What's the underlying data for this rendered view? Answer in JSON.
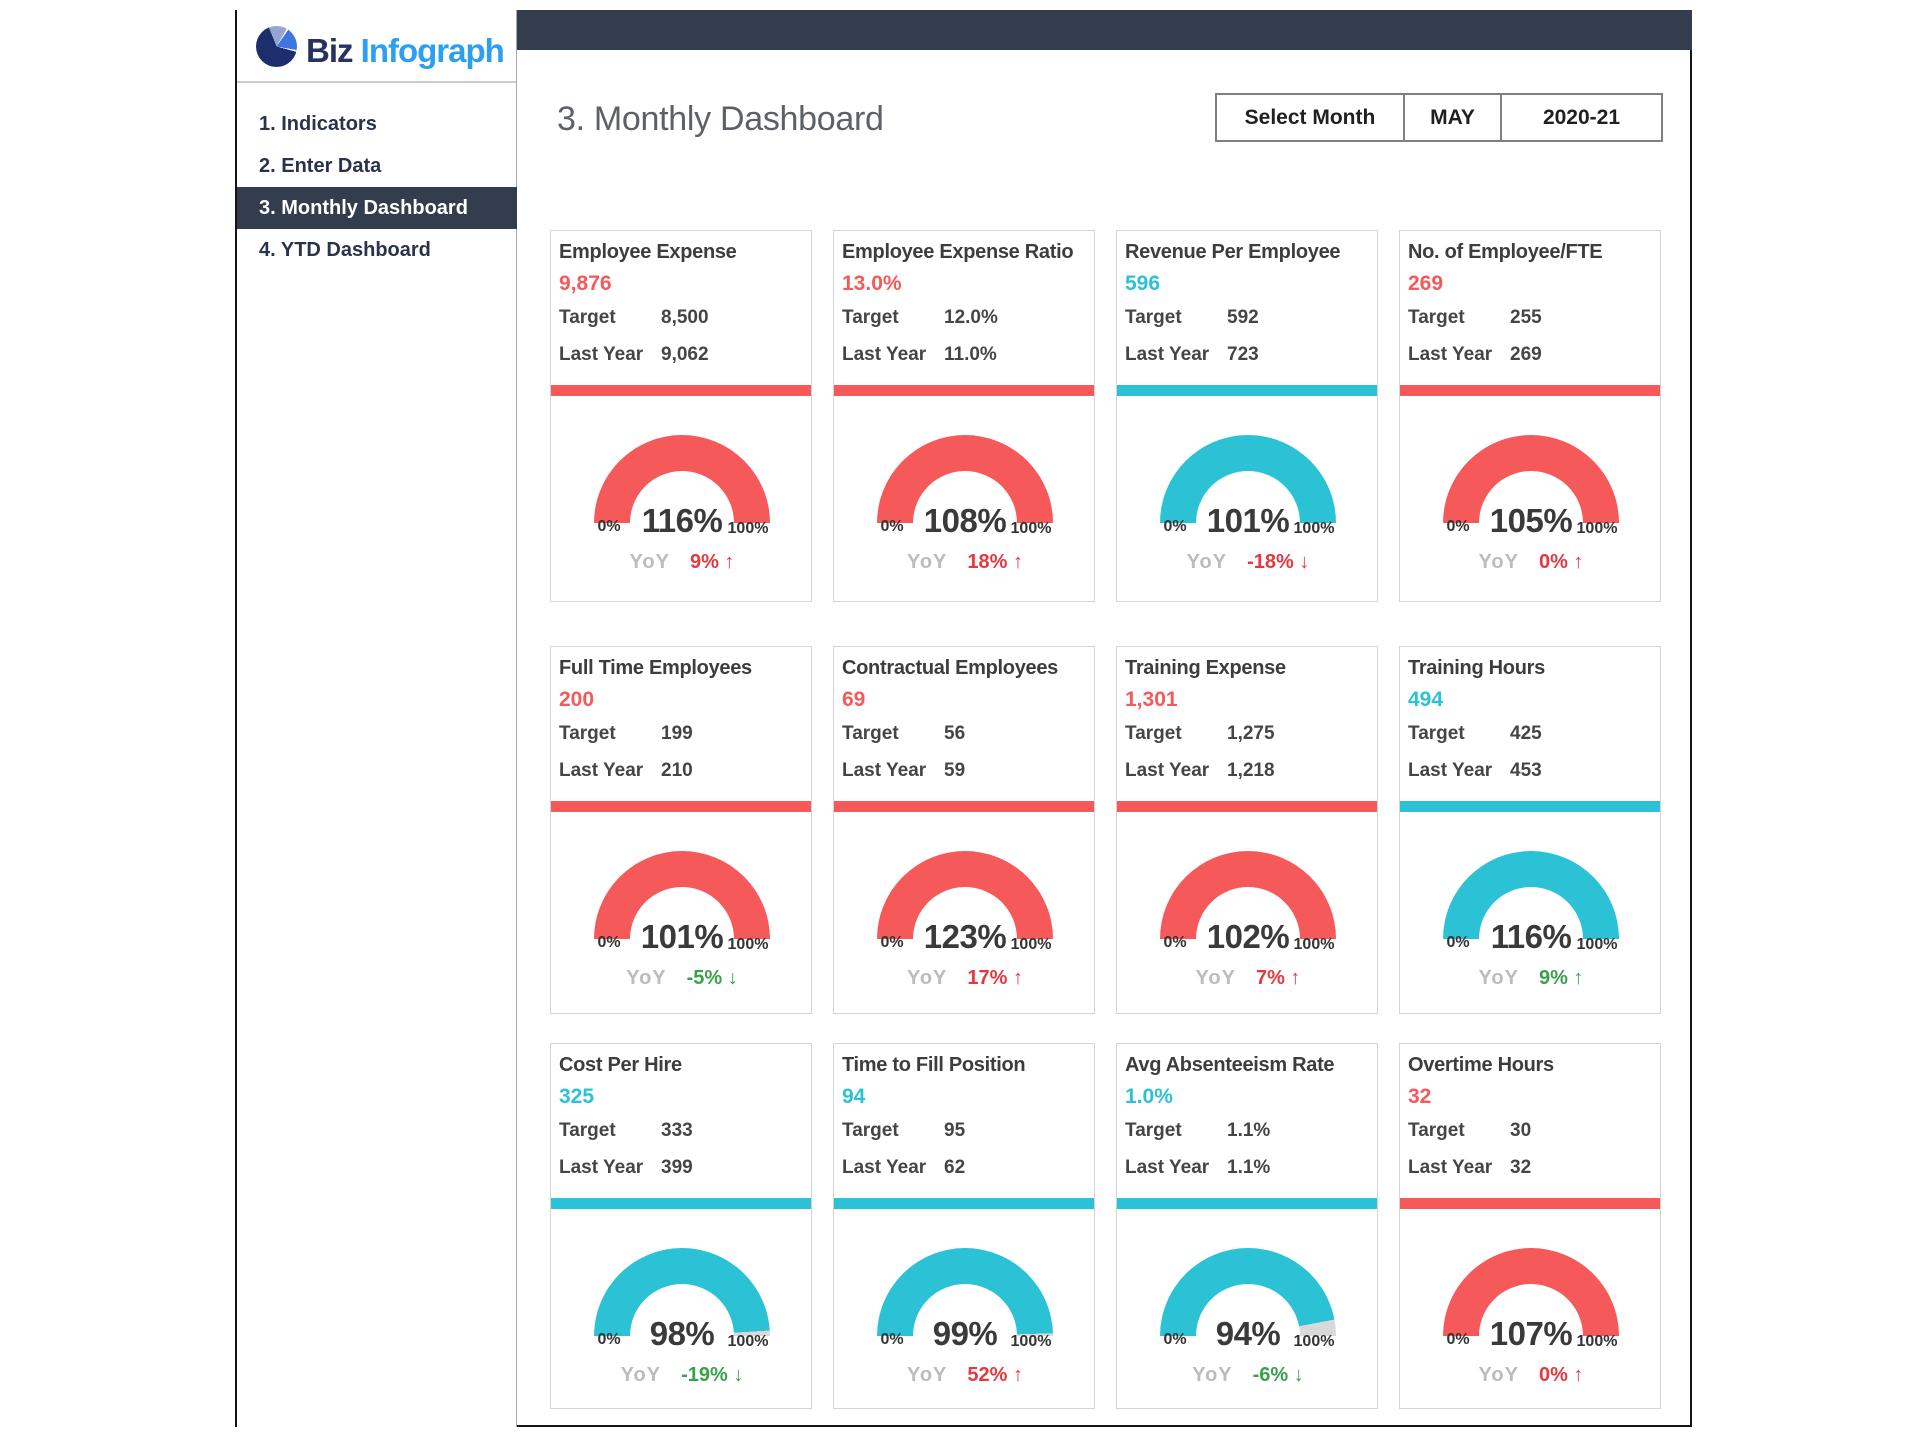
{
  "brand": {
    "name_part1": "Biz",
    "name_part2": "Infograph",
    "icon": "pie-chart-logo"
  },
  "sidebar": {
    "items": [
      {
        "label": "1. Indicators",
        "selected": false
      },
      {
        "label": "2. Enter Data",
        "selected": false
      },
      {
        "label": "3. Monthly Dashboard",
        "selected": true
      },
      {
        "label": "4. YTD Dashboard",
        "selected": false
      }
    ]
  },
  "header": {
    "title": "3. Monthly Dashboard",
    "buttons": [
      {
        "label": "Select Month"
      },
      {
        "label": "MAY"
      },
      {
        "label": "2020-21"
      }
    ]
  },
  "card_labels": {
    "target": "Target",
    "last_year": "Last Year",
    "yoy": "YoY",
    "gauge_min": "0%",
    "gauge_max": "100%"
  },
  "colors": {
    "red": "#f6595a",
    "teal": "#2cc2d5",
    "green": "#3aa14a",
    "yoy_red": "#e23a40",
    "gauge_remainder": "#d9d9d9",
    "navy": "#343d4e"
  },
  "cards": [
    {
      "title": "Employee Expense",
      "value": "9,876",
      "value_theme": "red",
      "target": "8,500",
      "last_year": "9,062",
      "gauge_theme": "red",
      "percent": 116,
      "percent_label": "116%",
      "yoy": {
        "value": "9%",
        "direction": "up",
        "theme": "red"
      }
    },
    {
      "title": "Employee Expense Ratio",
      "value": "13.0%",
      "value_theme": "red",
      "target": "12.0%",
      "last_year": "11.0%",
      "gauge_theme": "red",
      "percent": 108,
      "percent_label": "108%",
      "yoy": {
        "value": "18%",
        "direction": "up",
        "theme": "red"
      }
    },
    {
      "title": "Revenue Per Employee",
      "value": "596",
      "value_theme": "teal",
      "target": "592",
      "last_year": "723",
      "gauge_theme": "teal",
      "percent": 101,
      "percent_label": "101%",
      "yoy": {
        "value": "-18%",
        "direction": "down",
        "theme": "red"
      }
    },
    {
      "title": "No. of Employee/FTE",
      "value": "269",
      "value_theme": "red",
      "target": "255",
      "last_year": "269",
      "gauge_theme": "red",
      "percent": 105,
      "percent_label": "105%",
      "yoy": {
        "value": "0%",
        "direction": "up",
        "theme": "red"
      }
    },
    {
      "title": "Full Time Employees",
      "value": "200",
      "value_theme": "red",
      "target": "199",
      "last_year": "210",
      "gauge_theme": "red",
      "percent": 101,
      "percent_label": "101%",
      "yoy": {
        "value": "-5%",
        "direction": "down",
        "theme": "green"
      }
    },
    {
      "title": "Contractual Employees",
      "value": "69",
      "value_theme": "red",
      "target": "56",
      "last_year": "59",
      "gauge_theme": "red",
      "percent": 123,
      "percent_label": "123%",
      "yoy": {
        "value": "17%",
        "direction": "up",
        "theme": "red"
      }
    },
    {
      "title": "Training Expense",
      "value": "1,301",
      "value_theme": "red",
      "target": "1,275",
      "last_year": "1,218",
      "gauge_theme": "red",
      "percent": 102,
      "percent_label": "102%",
      "yoy": {
        "value": "7%",
        "direction": "up",
        "theme": "red"
      }
    },
    {
      "title": "Training Hours",
      "value": "494",
      "value_theme": "teal",
      "target": "425",
      "last_year": "453",
      "gauge_theme": "teal",
      "percent": 116,
      "percent_label": "116%",
      "yoy": {
        "value": "9%",
        "direction": "up",
        "theme": "green"
      }
    },
    {
      "title": "Cost Per Hire",
      "value": "325",
      "value_theme": "teal",
      "target": "333",
      "last_year": "399",
      "gauge_theme": "teal",
      "percent": 98,
      "percent_label": "98%",
      "yoy": {
        "value": "-19%",
        "direction": "down",
        "theme": "green"
      }
    },
    {
      "title": "Time to Fill Position",
      "value": "94",
      "value_theme": "teal",
      "target": "95",
      "last_year": "62",
      "gauge_theme": "teal",
      "percent": 99,
      "percent_label": "99%",
      "yoy": {
        "value": "52%",
        "direction": "up",
        "theme": "red"
      }
    },
    {
      "title": "Avg Absenteeism Rate",
      "value": "1.0%",
      "value_theme": "teal",
      "target": "1.1%",
      "last_year": "1.1%",
      "gauge_theme": "teal",
      "percent": 94,
      "percent_label": "94%",
      "yoy": {
        "value": "-6%",
        "direction": "down",
        "theme": "green"
      }
    },
    {
      "title": "Overtime Hours",
      "value": "32",
      "value_theme": "red",
      "target": "30",
      "last_year": "32",
      "gauge_theme": "red",
      "percent": 107,
      "percent_label": "107%",
      "yoy": {
        "value": "0%",
        "direction": "up",
        "theme": "red"
      }
    }
  ]
}
